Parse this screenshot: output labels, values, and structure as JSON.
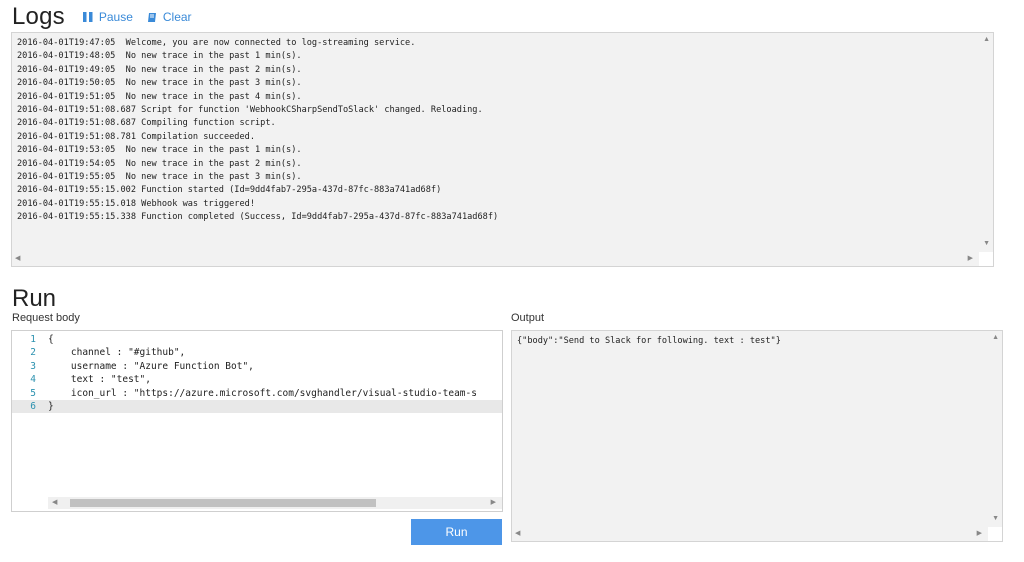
{
  "logs": {
    "title": "Logs",
    "pause_label": "Pause",
    "clear_label": "Clear",
    "lines": [
      "2016-04-01T19:47:05  Welcome, you are now connected to log-streaming service.",
      "2016-04-01T19:48:05  No new trace in the past 1 min(s).",
      "2016-04-01T19:49:05  No new trace in the past 2 min(s).",
      "2016-04-01T19:50:05  No new trace in the past 3 min(s).",
      "2016-04-01T19:51:05  No new trace in the past 4 min(s).",
      "2016-04-01T19:51:08.687 Script for function 'WebhookCSharpSendToSlack' changed. Reloading.",
      "2016-04-01T19:51:08.687 Compiling function script.",
      "2016-04-01T19:51:08.781 Compilation succeeded.",
      "2016-04-01T19:53:05  No new trace in the past 1 min(s).",
      "2016-04-01T19:54:05  No new trace in the past 2 min(s).",
      "2016-04-01T19:55:05  No new trace in the past 3 min(s).",
      "2016-04-01T19:55:15.002 Function started (Id=9dd4fab7-295a-437d-87fc-883a741ad68f)",
      "2016-04-01T19:55:15.018 Webhook was triggered!",
      "2016-04-01T19:55:15.338 Function completed (Success, Id=9dd4fab7-295a-437d-87fc-883a741ad68f)"
    ]
  },
  "run": {
    "title": "Run",
    "request_body_label": "Request body",
    "output_label": "Output",
    "run_button_label": "Run",
    "code_lines": [
      {
        "num": "1",
        "text": "{"
      },
      {
        "num": "2",
        "text": "    channel : \"#github\","
      },
      {
        "num": "3",
        "text": "    username : \"Azure Function Bot\","
      },
      {
        "num": "4",
        "text": "    text : \"test\","
      },
      {
        "num": "5",
        "text": "    icon_url : \"https://azure.microsoft.com/svghandler/visual-studio-team-s"
      },
      {
        "num": "6",
        "text": "}"
      }
    ],
    "output_text": "{\"body\":\"Send to Slack for following. text : test\"}"
  },
  "colors": {
    "accent": "#4d96e8",
    "link": "#3a8ad8",
    "panel_bg": "#f2f2f2",
    "line_number": "#2b91af"
  }
}
